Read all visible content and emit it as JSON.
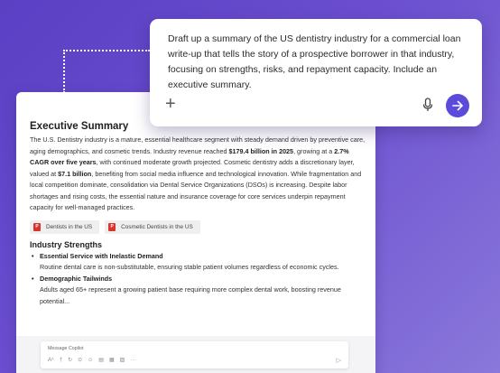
{
  "prompt": {
    "text": "Draft up a summary of the US dentistry industry for a commercial loan write-up that tells the story of a prospective borrower in that industry, focusing on strengths, risks, and repayment capacity. Include an executive summary.",
    "add_icon": "plus-icon",
    "mic_icon": "microphone-icon",
    "send_icon": "arrow-right-icon"
  },
  "document": {
    "title": "Executive Summary",
    "summary": {
      "p1": "The U.S. Dentistry industry is a mature, essential healthcare segment with steady demand driven by preventive care, aging demographics, and cosmetic trends. Industry revenue reached ",
      "b1": "$179.4 billion in 2025",
      "p2": ", growing at a ",
      "b2": "2.7% CAGR over five years",
      "p3": ", with continued moderate growth projected. Cosmetic dentistry adds a discretionary layer, valued at ",
      "b3": "$7.1 billion",
      "p4": ", benefiting from social media influence and technological innovation. While fragmentation and local competition dominate, consolidation via Dental Service Organizations (DSOs) is increasing. Despite labor shortages and rising costs, the essential nature and insurance coverage for core services underpin repayment capacity for well-managed practices."
    },
    "citations": [
      {
        "label": "Dentists in the US",
        "icon": "pdf-icon"
      },
      {
        "label": "Cosmetic Dentists in the US",
        "icon": "pdf-icon"
      }
    ],
    "strengths_heading": "Industry Strengths",
    "strengths": [
      {
        "title": "Essential Service with Inelastic Demand",
        "body": "Routine dental care is non-substitutable, ensuring stable patient volumes regardless of economic cycles."
      },
      {
        "title": "Demographic Tailwinds",
        "body": "Adults aged 65+ represent a growing patient base requiring more complex dental work, boosting revenue potential..."
      }
    ]
  },
  "composer": {
    "placeholder": "Message Copilot",
    "tools": [
      "Aᴬ",
      "†",
      "↻",
      "⊙",
      "☺",
      "▤",
      "▦",
      "▧",
      "···"
    ],
    "send_icon": "send-icon"
  },
  "colors": {
    "accent": "#5b4bdb",
    "background_start": "#5b3fc4",
    "background_end": "#8a78da",
    "pdf_red": "#d9342b"
  }
}
